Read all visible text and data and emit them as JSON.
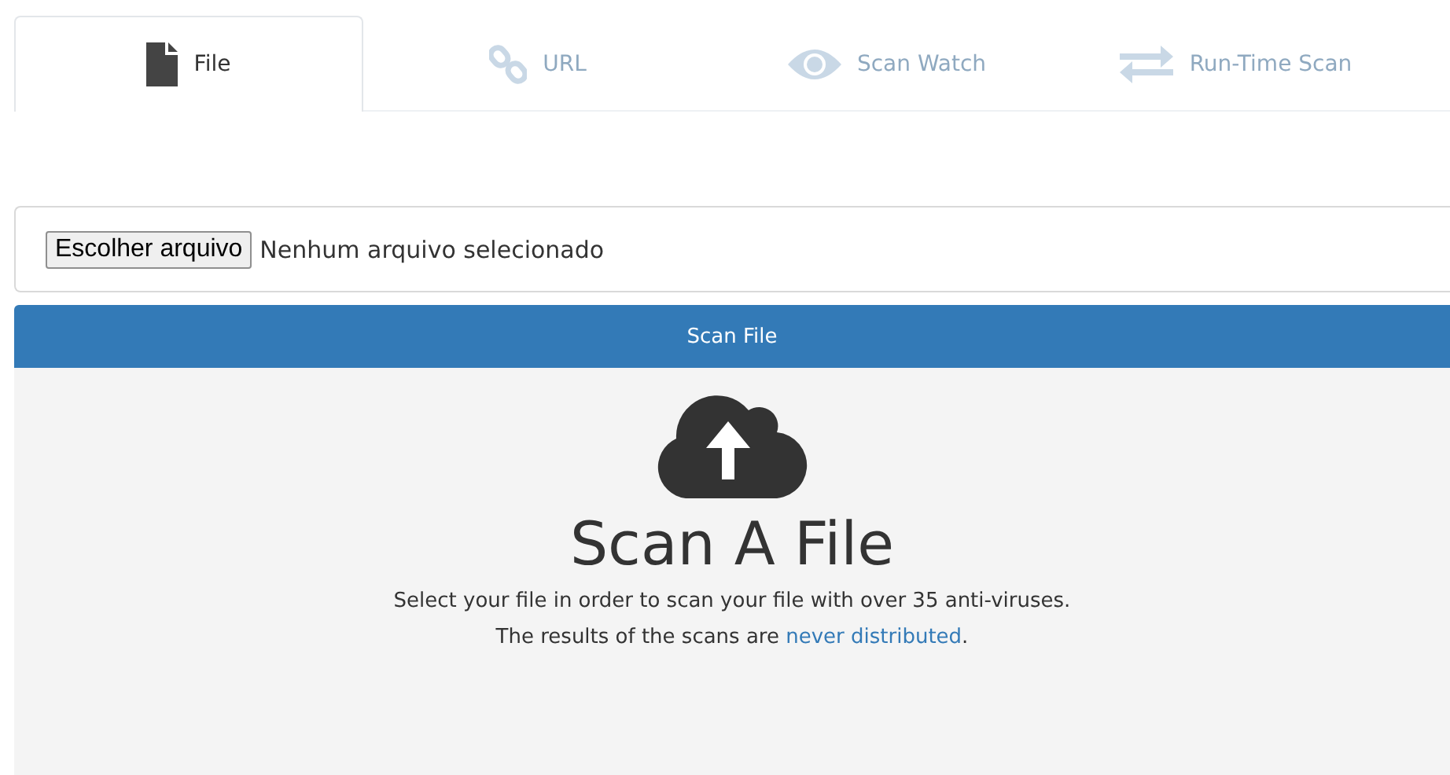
{
  "tabs": [
    {
      "label": "File",
      "selected": true
    },
    {
      "label": "URL",
      "selected": false
    },
    {
      "label": "Scan Watch",
      "selected": false
    },
    {
      "label": "Run-Time Scan",
      "selected": false
    }
  ],
  "file_input": {
    "button": "Escolher arquivo",
    "status": "Nenhum arquivo selecionado"
  },
  "scan_button": "Scan File",
  "drop_zone": {
    "title": "Scan A File",
    "description": "Select your file in order to scan your file with over 35 anti-viruses.",
    "note_before": "The results of the scans are ",
    "note_link": "never distributed",
    "note_after": "."
  }
}
